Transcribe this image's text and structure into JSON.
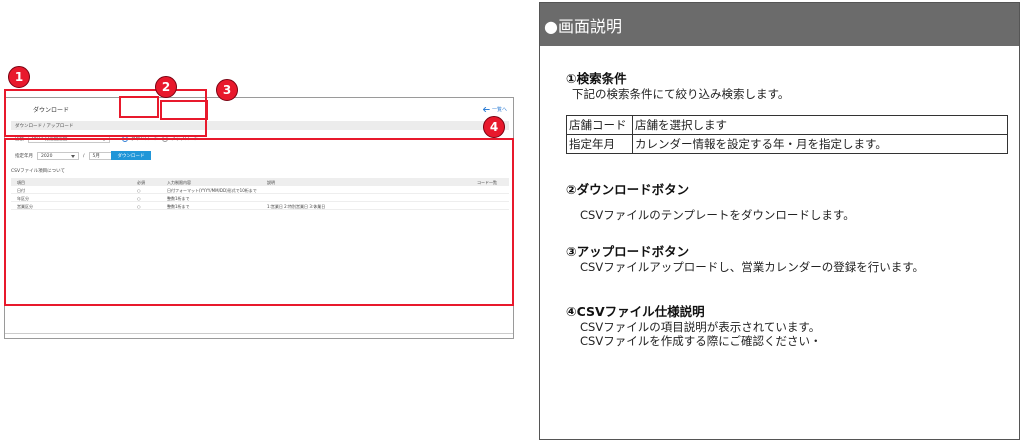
{
  "app": {
    "title": "ダウンロード",
    "header_link": "一覧へ",
    "section_label": "ダウンロード / アップロード",
    "store_label": "店舗",
    "store_value": "0011 分店舗店舗",
    "radio_download": "ダウンロード",
    "radio_upload": "アップロード",
    "date_label": "指定年月",
    "year_value": "2020",
    "month_value": "5月",
    "download_button": "ダウンロード",
    "spec_title": "CSVファイル項目について",
    "table_headers": [
      "項目",
      "必須",
      "入力制限内容",
      "説明",
      "コード一覧"
    ],
    "table_rows": [
      [
        "日付",
        "○",
        "日付フォーマット(YYYY/MM/DD)形式で10桁まで",
        "",
        ""
      ],
      [
        "年区分",
        "○",
        "整数1桁まで",
        "",
        ""
      ],
      [
        "営業区分",
        "○",
        "整数1桁まで",
        "1:営業日 2:特別営業日 3:休業日",
        ""
      ]
    ]
  },
  "badges": [
    "1",
    "2",
    "3",
    "4"
  ],
  "panel": {
    "header": "●画面説明",
    "s1_title": "①検索条件",
    "s1_text": "下記の検索条件にて絞り込み検索します。",
    "table": [
      [
        "店舗コード",
        "店舗を選択します"
      ],
      [
        "指定年月",
        "カレンダー情報を設定する年・月を指定します。"
      ]
    ],
    "s2_title": "②ダウンロードボタン",
    "s2_text": "CSVファイルのテンプレートをダウンロードします。",
    "s3_title": "③アップロードボタン",
    "s3_text": "CSVファイルアップロードし、営業カレンダーの登録を行います。",
    "s4_title": "④CSVファイル仕様説明",
    "s4_text1": "CSVファイルの項目説明が表示されています。",
    "s4_text2": "CSVファイルを作成する際にご確認ください・"
  },
  "colors": {
    "annotation": "#e8192c",
    "accent": "#2196d8",
    "panel_header": "#6b6b6b"
  }
}
